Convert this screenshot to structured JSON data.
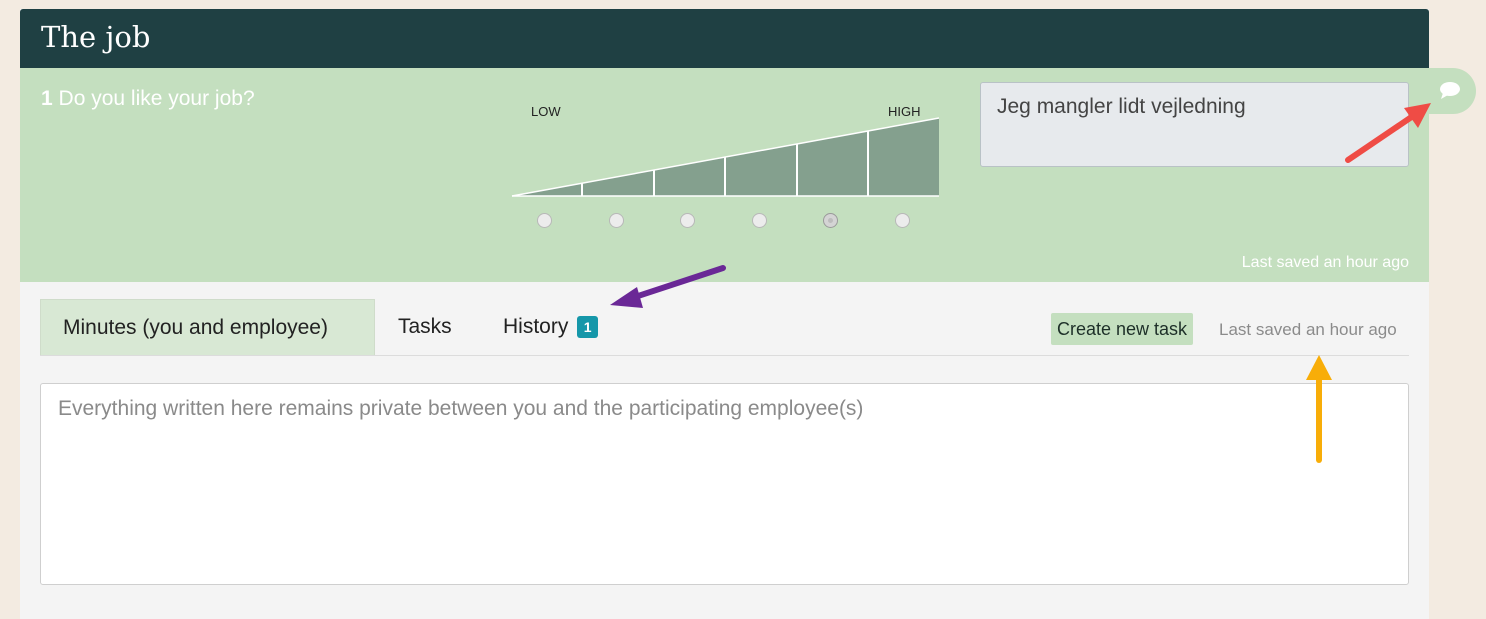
{
  "header": {
    "title": "The job"
  },
  "question": {
    "number": "1",
    "text": "Do you like your job?",
    "scale_low_label": "LOW",
    "scale_high_label": "HIGH",
    "scale_steps": 6,
    "selected_step": 5,
    "comment": "Jeg mangler lidt vejledning",
    "last_saved": "Last saved an hour ago"
  },
  "tabs": [
    {
      "label": "Minutes (you and employee)",
      "active": true
    },
    {
      "label": "Tasks",
      "active": false
    },
    {
      "label": "History",
      "active": false,
      "badge": "1"
    }
  ],
  "actions": {
    "create_task_label": "Create new task",
    "last_saved": "Last saved an hour ago"
  },
  "notes": {
    "placeholder": "Everything written here remains private between you and the participating employee(s)",
    "value": ""
  },
  "colors": {
    "header_bg": "#1f4043",
    "question_bg": "#c4dfbf",
    "badge": "#1597a9",
    "arrow_red": "#ef4c45",
    "arrow_purple": "#6a2896",
    "arrow_orange": "#f8ad08"
  }
}
